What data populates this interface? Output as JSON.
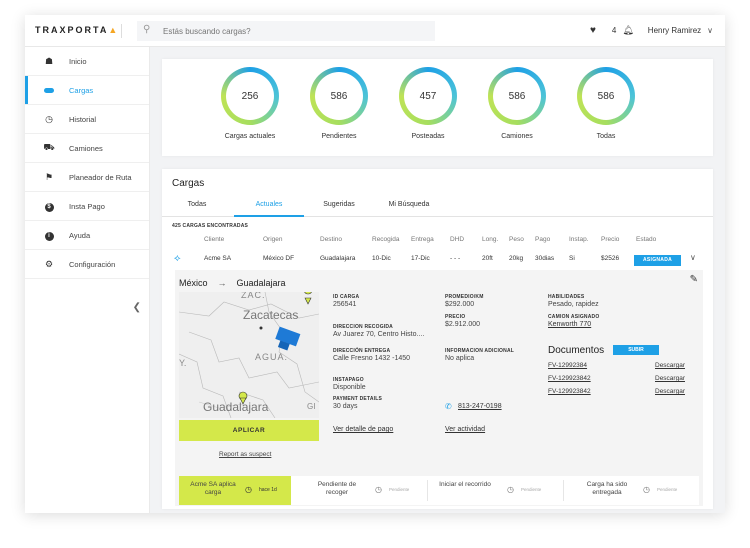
{
  "app": {
    "logo_text": "TRAXPORTA",
    "search_placeholder": "Estás buscando cargas?",
    "notif_count": "4",
    "user_name": "Henry Ramirez"
  },
  "sidebar": {
    "items": [
      {
        "label": "Inicio",
        "icon": "home-icon"
      },
      {
        "label": "Cargas",
        "icon": "cargo-icon",
        "active": true
      },
      {
        "label": "Historial",
        "icon": "clock-icon"
      },
      {
        "label": "Camiones",
        "icon": "truck-icon"
      },
      {
        "label": "Planeador de Ruta",
        "icon": "flag-icon"
      },
      {
        "label": "Insta Pago",
        "icon": "dollar-icon"
      },
      {
        "label": "Ayuda",
        "icon": "info-icon"
      },
      {
        "label": "Configuración",
        "icon": "gear-icon"
      }
    ]
  },
  "stats": [
    {
      "value": "256",
      "label": "Cargas actuales"
    },
    {
      "value": "586",
      "label": "Pendientes"
    },
    {
      "value": "457",
      "label": "Posteadas"
    },
    {
      "value": "586",
      "label": "Camiones"
    },
    {
      "value": "586",
      "label": "Todas"
    }
  ],
  "loads": {
    "title": "Cargas",
    "tabs": [
      "Todas",
      "Actuales",
      "Sugeridas",
      "Mi Búsqueda"
    ],
    "active_tab": 1,
    "found_text": "425 CARGAS ENCONTRADAS",
    "columns": [
      "Cliente",
      "Origen",
      "Destino",
      "Recogida",
      "Entrega",
      "DHD",
      "Long.",
      "Peso",
      "Pago",
      "Instap.",
      "Precio",
      "Estado"
    ],
    "row": {
      "cliente": "Acme SA",
      "origen": "México DF",
      "destino": "Guadalajara",
      "recogida": "10-Dic",
      "entrega": "17-Dic",
      "dhd": "- - -",
      "long": "20ft",
      "peso": "20kg",
      "pago": "30dias",
      "instap": "Si",
      "precio": "$2526",
      "estado": "ASIGNADA"
    }
  },
  "detail": {
    "route_from": "México",
    "route_to": "Guadalajara",
    "map_labels": [
      "ZAC.",
      "Zacatecas",
      "AGUA.",
      "Y.",
      "Guadalajara",
      "GI"
    ],
    "id_label": "ID CARGA",
    "id_value": "256541",
    "pickup_label": "DIRECCION RECOGIDA",
    "pickup_value": "Av Juarez 70, Centro Histo....",
    "delivery_label": "DIRECCIÓN ENTREGA",
    "delivery_value": "Calle Fresno 1432 -1450",
    "instapago_label": "INSTAPAGO",
    "instapago_value": "Disponible",
    "payment_label": "PAYMENT DETAILS",
    "payment_value": "30 days",
    "payment_link": "Ver detalle de pago",
    "avg_label": "PROMEDIO/KM",
    "avg_value": "$292.000",
    "price_label": "PRECIO",
    "price_value": "$2.912.000",
    "info_label": "INFORMACION ADICIONAL",
    "info_value": "No aplica",
    "phone": "813-247-0198",
    "activity_link": "Ver actividad",
    "skills_label": "HABILIDADES",
    "skills_value": "Pesado, rapidez",
    "truck_label": "CAMION ASIGNADO",
    "truck_value": "Kenworth 770",
    "docs_title": "Documentos",
    "upload_label": "SUBIR",
    "docs": [
      "FV-12992384",
      "FV-129923842",
      "FV-129923842"
    ],
    "download_label": "Descargar",
    "apply_label": "APLICAR",
    "report_label": "Report as suspect"
  },
  "timeline": [
    {
      "title": "Acme SA aplica carga",
      "status": "hace 1d",
      "done": true
    },
    {
      "title": "Pendiente de recoger",
      "status": "Pendiente",
      "done": false
    },
    {
      "title": "Iniciar el recorrido",
      "status": "Pendiente",
      "done": false
    },
    {
      "title": "Carga ha sido entregada",
      "status": "Pendiente",
      "done": false
    }
  ],
  "colors": {
    "accent": "#1ea0e6",
    "lime": "#d4e84a",
    "brand_dot": "#f5a623"
  }
}
